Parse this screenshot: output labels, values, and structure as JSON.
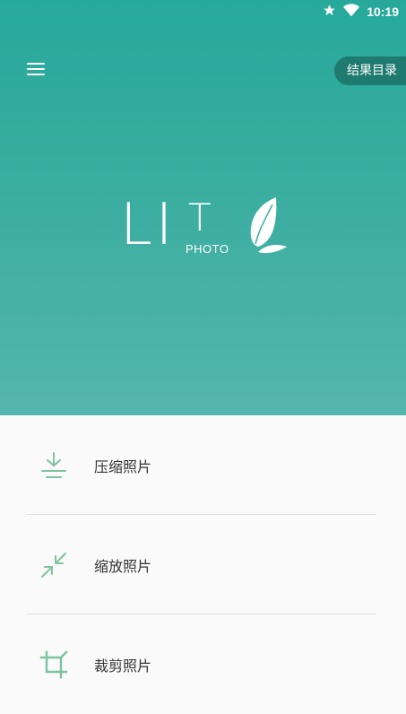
{
  "status_bar": {
    "time": "10:19"
  },
  "header": {
    "results_label": "结果目录"
  },
  "logo": {
    "big_text": "LI",
    "t_text": "T",
    "sub_text": "PHOTO"
  },
  "menu_items": [
    {
      "label": "压缩照片",
      "icon": "compress-icon"
    },
    {
      "label": "缩放照片",
      "icon": "resize-icon"
    },
    {
      "label": "裁剪照片",
      "icon": "crop-icon"
    }
  ],
  "colors": {
    "accent": "#2aa89a",
    "icon": "#7cc3a0",
    "text": "#333333"
  }
}
